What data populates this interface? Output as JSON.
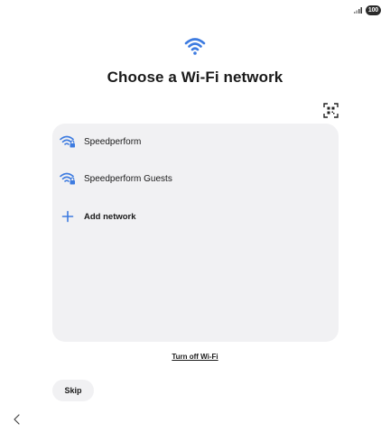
{
  "status_bar": {
    "signal_icon": "signal-bars-icon",
    "battery_level": "100"
  },
  "header": {
    "icon": "wifi-icon",
    "title": "Choose a Wi-Fi network"
  },
  "toolbar": {
    "qr_icon": "qr-scan-icon"
  },
  "networks": [
    {
      "name": "Speedperform",
      "icon": "wifi-locked-icon"
    },
    {
      "name": "Speedperform Guests",
      "icon": "wifi-locked-icon"
    }
  ],
  "add_network": {
    "label": "Add network",
    "icon": "plus-icon"
  },
  "footer": {
    "turn_off_label": "Turn off Wi-Fi",
    "skip_label": "Skip",
    "back_icon": "chevron-left-icon"
  },
  "colors": {
    "accent": "#3d7be0",
    "panel_bg": "#f1f1f3",
    "text": "#1a1a1a"
  }
}
